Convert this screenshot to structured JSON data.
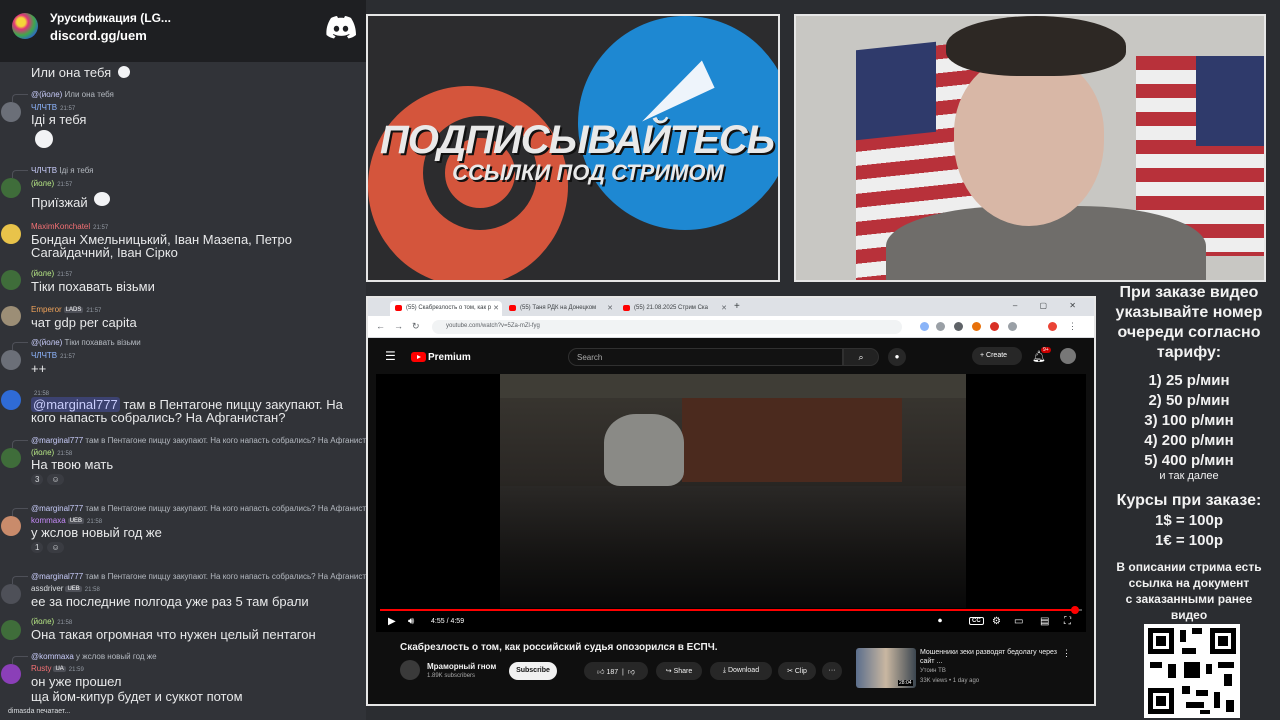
{
  "server": {
    "name": "Урусификация (LG...",
    "invite": "discord.gg/uem",
    "discord_icon": "discord-logo-icon"
  },
  "messages": [
    {
      "text": "Или она тебя"
    },
    {
      "reply_name": "@(йоле)",
      "reply_text": "Или она тебя",
      "user": "ЧЛЧТВ",
      "time": "21:57",
      "text": "Іді я тебя"
    },
    {
      "reply_name": "ЧЛЧТВ",
      "reply_text": "Іді я тебя",
      "user": "(йоле)",
      "time": "21:57",
      "text": "Приїзжай"
    },
    {
      "user": "MaximKonchatel",
      "time": "21:57",
      "text": "Бондан Хмельницький, Іван Мазепа, Петро Сагайдачний, Іван Сірко"
    },
    {
      "user": "(йоле)",
      "time": "21:57",
      "text": "Тіки похавать візьми"
    },
    {
      "user": "Emperor",
      "badge": "LADS",
      "time": "21:57",
      "text": "чат gdp per capita"
    },
    {
      "reply_name": "@(йоле)",
      "reply_text": "Тіки похавать візьми",
      "user": "ЧЛЧТВ",
      "time": "21:57",
      "text": "++"
    },
    {
      "user": "",
      "time": "21:58",
      "mention": "@marginal777",
      "text": "там в Пентагоне пиццу закупают. На кого напасть собрались? На Афганистан?"
    },
    {
      "reply_name": "@marginal777",
      "reply_text": "там в Пентагоне пиццу закупают. На кого напасть собрались? На Афганиста",
      "user": "(йоле)",
      "time": "21:58",
      "text": "На твою мать",
      "reaction_1": "3",
      "reaction_2": ""
    },
    {
      "reply_name": "@marginal777",
      "reply_text": "там в Пентагоне пиццу закупают. На кого напасть собрались? На Афганиста",
      "user": "kommaxa",
      "badge": "UEB",
      "time": "21:58",
      "text": "у жслов новый год же",
      "reaction_1": "1",
      "reaction_2": ""
    },
    {
      "reply_name": "@marginal777",
      "reply_text": "там в Пентагоне пиццу закупают. На кого напасть собрались? На Афганиста",
      "user": "assdriver",
      "badge": "UEB",
      "time": "21:58",
      "text": "ее за последние полгода уже раз 5 там брали"
    },
    {
      "user": "(йоле)",
      "time": "21:58",
      "text": "Она такая огромная что нужен целый пентагон"
    },
    {
      "reply_name": "@kommaxa",
      "reply_text": "у жслов новый год же",
      "user": "Rusty",
      "badge": "UA",
      "time": "21:59",
      "text": "он уже прошел",
      "text2": "ща йом-кипур будет и суккот потом"
    }
  ],
  "typing": "dimasda печатает...",
  "promo": {
    "title": "ПОДПИСЫВАЙТЕСЬ",
    "subtitle": "ССЫЛКИ ПОД СТРИМОМ"
  },
  "browser": {
    "tabs": [
      "(55) Скабрезлость о том, как р",
      "(55) Таня РДК на Донецком",
      "(55) 21.08.2025 Стрим Ска"
    ],
    "url": "youtube.com/watch?v=5Za-mZl-fyg",
    "new_tab": "+",
    "win_controls": "– ▢ ✕"
  },
  "youtube": {
    "premium": "Premium",
    "search_placeholder": "Search",
    "create": "Create",
    "notif_count": "9+",
    "time": "4:55 / 4:59",
    "progress": 0.99,
    "cc": "CC",
    "title": "Скабрезлость о том, как российский судья опозорился в ЕСПЧ.",
    "channel": "Мраморный гном",
    "subs": "1.89K subscribers",
    "subscribe": "Subscribe",
    "likes": "187",
    "share": "Share",
    "download": "Download",
    "clip": "Clip",
    "more": "···",
    "rec": {
      "title": "Мошенники зеки разводят бедолагу через сайт ...",
      "channel": "Утоин ТВ",
      "meta": "33K views • 1 day ago",
      "duration": "28:04"
    }
  },
  "info": {
    "order_1": "При заказе видео",
    "order_2": "указывайте номер",
    "order_3": "очереди согласно",
    "order_4": "тарифу:",
    "tariffs": [
      "1) 25 р/мин",
      "2) 50 р/мин",
      "3) 100 р/мин",
      "4) 200 р/мин",
      "5) 400 р/мин"
    ],
    "etc": "и так далее",
    "rates_title": "Курсы при заказе:",
    "rate_usd": "1$ = 100р",
    "rate_eur": "1€ = 100р",
    "desc_1": "В описании стрима есть",
    "desc_2": "ссылка на документ",
    "desc_3": "с заказанными ранее",
    "desc_4": "видео"
  }
}
